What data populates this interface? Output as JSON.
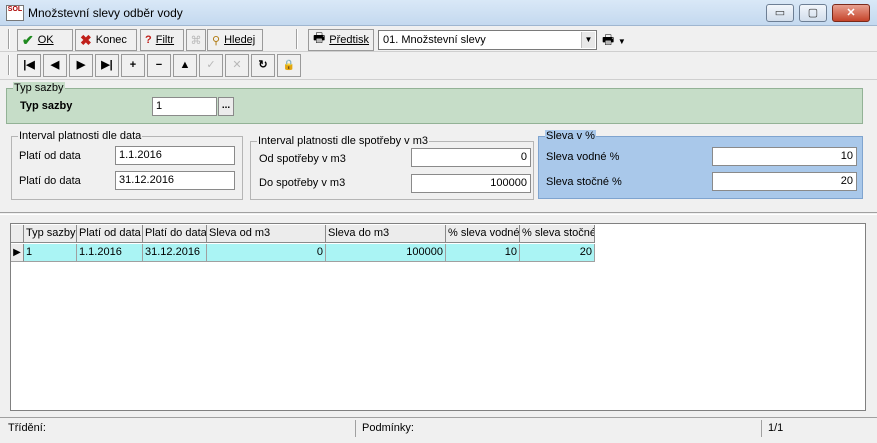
{
  "window": {
    "app_icon_text": "SOL",
    "title": "Množstevní slevy odběr vody",
    "minimize": "▭",
    "maximize": "▢",
    "close": "✕"
  },
  "toolbar": {
    "ok_label": "OK",
    "konec_label": "Konec",
    "filtr_label": "Filtr",
    "hledej_label": "Hledej",
    "predtisk_label": "Předtisk",
    "predtisk_combo_value": "01. Množstevní slevy"
  },
  "nav": {
    "first": "|◀",
    "prev": "◀",
    "next": "▶",
    "last": "▶|",
    "add": "+",
    "remove": "−",
    "up": "▲",
    "confirm": "✓",
    "cancel": "✕",
    "refresh": "↻",
    "lock": "🔒"
  },
  "typ_sazby_group": {
    "title": "Typ sazby",
    "label": "Typ sazby",
    "value": "1",
    "browse": "..."
  },
  "interval_data": {
    "title": "Interval platnosti dle data",
    "od_label": "Platí od data",
    "od_value": "1.1.2016",
    "do_label": "Platí do data",
    "do_value": "31.12.2016"
  },
  "interval_spotreby": {
    "title": "Interval platnosti dle spotřeby v m3",
    "od_label": "Od spotřeby v m3",
    "od_value": "0",
    "do_label": "Do spotřeby v m3",
    "do_value": "100000"
  },
  "sleva": {
    "title": "Sleva v %",
    "vodne_label": "Sleva vodné %",
    "vodne_value": "10",
    "stocne_label": "Sleva stočné %",
    "stocne_value": "20"
  },
  "grid": {
    "columns": [
      "Typ sazby",
      "Platí od data",
      "Platí do data",
      "Sleva od m3",
      "Sleva do m3",
      "% sleva vodné",
      "% sleva stočné"
    ],
    "rows": [
      [
        "1",
        "1.1.2016",
        "31.12.2016",
        "0",
        "100000",
        "10",
        "20"
      ]
    ]
  },
  "status": {
    "trideni": "Třídění:",
    "podminky": "Podmínky:",
    "pages": "1/1"
  },
  "colors": {
    "green_panel": "#c6ddc8",
    "blue_panel": "#a9c8ea",
    "selected_row": "#aaf4f4"
  }
}
